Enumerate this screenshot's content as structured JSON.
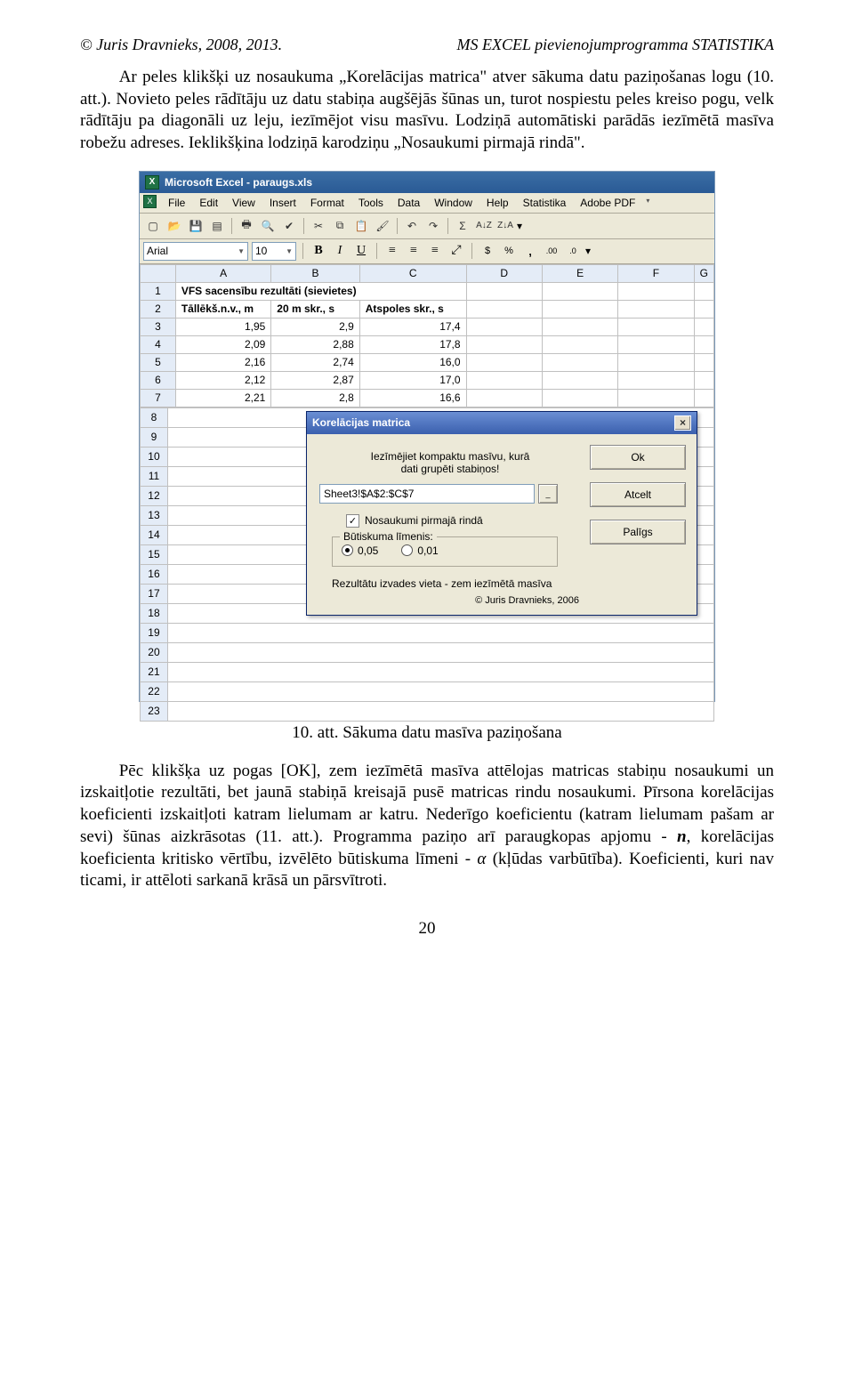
{
  "header": {
    "left": "© Juris Dravnieks, 2008, 2013.",
    "right": "MS EXCEL pievienojumprogramma STATISTIKA"
  },
  "para1_a": "Ar peles klikšķi uz nosaukuma „Korelācijas matrica\" atver sākuma datu paziņošanas logu (10. att.). Novieto peles rādītāju uz datu stabiņa augšējās šūnas un, turot nospiestu peles kreiso pogu, velk rādītāju pa diagonāli uz leju, iezīmējot visu masīvu. Lodziņā automātiski parādās iezīmētā masīva robežu adreses. Ieklikšķina lodziņā karodziņu „Nosaukumi pirmajā rindā\".",
  "caption": "10. att.     Sākuma datu masīva paziņošana",
  "para2_a": "Pēc klikšķa uz pogas [OK], zem iezīmētā masīva attēlojas matricas stabiņu nosaukumi un izskaitļotie rezultāti, bet jaunā stabiņā kreisajā pusē matricas rindu nosaukumi. Pīrsona korelācijas koeficienti izskaitļoti katram lielumam ar katru. Nederīgo koeficientu (katram lielumam pašam ar sevi) šūnas aizkrāsotas (11. att.). Programma paziņo arī paraugkopas apjomu - ",
  "para2_b": ", korelācijas koeficienta kritisko vērtību, izvēlēto būtiskuma līmeni - ",
  "para2_c": " (kļūdas varbūtība). Koeficienti, kuri nav ticami, ir attēloti sarkanā krāsā un pārsvītroti.",
  "n_sym": "n",
  "alpha_sym": "α",
  "pagenum": "20",
  "excel": {
    "title": "Microsoft Excel - paraugs.xls",
    "menu": [
      "File",
      "Edit",
      "View",
      "Insert",
      "Format",
      "Tools",
      "Data",
      "Window",
      "Help",
      "Statistika",
      "Adobe PDF"
    ],
    "font_name": "Arial",
    "font_size": "10",
    "cols": [
      "",
      "A",
      "B",
      "C",
      "D",
      "E",
      "F",
      "G"
    ],
    "rows": [
      {
        "n": "1",
        "a": "VFS sacensību rezultāti (sievietes)",
        "bold": true,
        "span": true
      },
      {
        "n": "2",
        "a": "Tāllēkš.n.v., m",
        "b": "20 m skr., s",
        "c": "Atspoles skr., s",
        "bold": true
      },
      {
        "n": "3",
        "a": "1,95",
        "b": "2,9",
        "c": "17,4"
      },
      {
        "n": "4",
        "a": "2,09",
        "b": "2,88",
        "c": "17,8"
      },
      {
        "n": "5",
        "a": "2,16",
        "b": "2,74",
        "c": "16,0"
      },
      {
        "n": "6",
        "a": "2,12",
        "b": "2,87",
        "c": "17,0"
      },
      {
        "n": "7",
        "a": "2,21",
        "b": "2,8",
        "c": "16,6"
      }
    ],
    "extrarows": [
      "8",
      "9",
      "10",
      "11",
      "12",
      "13",
      "14",
      "15",
      "16",
      "17",
      "18",
      "19",
      "20",
      "21",
      "22",
      "23"
    ]
  },
  "dialog": {
    "title": "Korelācijas matrica",
    "instr1": "Iezīmējiet kompaktu masīvu, kurā",
    "instr2": "dati grupēti stabiņos!",
    "ref": "Sheet3!$A$2:$C$7",
    "chk": "Nosaukumi pirmajā rindā",
    "group": "Būtiskuma līmenis:",
    "r1": "0,05",
    "r2": "0,01",
    "outnote": "Rezultātu izvades vieta - zem iezīmētā masīva",
    "copyright": "© Juris Dravnieks, 2006",
    "ok": "Ok",
    "cancel": "Atcelt",
    "help": "Palīgs"
  }
}
